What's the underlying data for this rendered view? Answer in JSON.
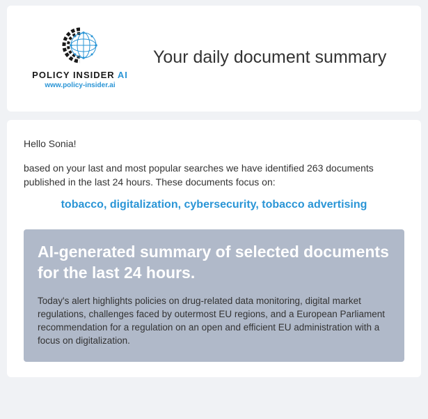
{
  "logo": {
    "brand_text_main": "POLICY INSIDER ",
    "brand_text_accent": "AI",
    "url": "www.policy-insider.ai"
  },
  "header": {
    "title": "Your daily document summary"
  },
  "body": {
    "greeting": "Hello Sonia!",
    "intro": "based on your last and most popular searches we have identified 263 documents published in the last 24 hours. These documents focus on:",
    "topics": "tobacco, digitalization, cybersecurity, tobacco advertising"
  },
  "summary": {
    "title": "AI-generated summary of selected documents for the last 24 hours.",
    "text": "Today's alert highlights policies on drug-related data monitoring, digital market regulations, challenges faced by outermost EU regions, and a European Parliament recommendation for a regulation on an open and efficient EU administration with a focus on digitalization."
  }
}
